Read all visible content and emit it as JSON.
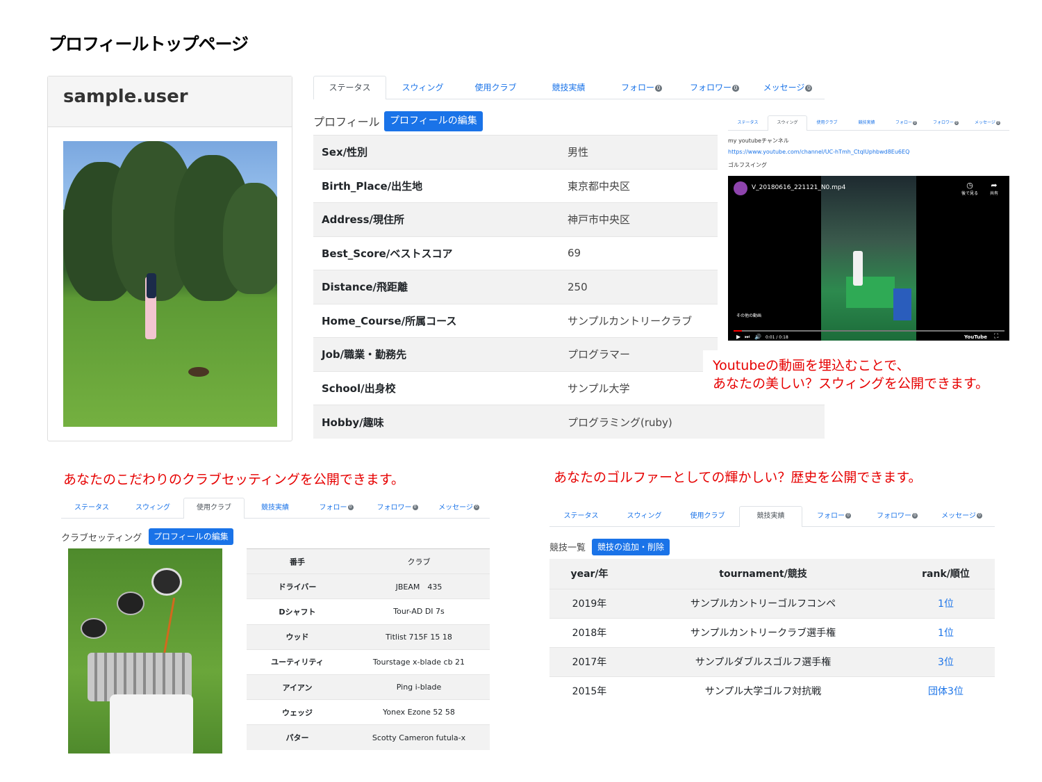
{
  "page_title": "プロフィールトップページ",
  "profile_card": {
    "username": "sample.user"
  },
  "tabs": [
    {
      "label": "ステータス",
      "badge": ""
    },
    {
      "label": "スウィング",
      "badge": ""
    },
    {
      "label": "使用クラブ",
      "badge": ""
    },
    {
      "label": "競技実績",
      "badge": ""
    },
    {
      "label": "フォロー",
      "badge": "0"
    },
    {
      "label": "フォロワー",
      "badge": "0"
    },
    {
      "label": "メッセージ",
      "badge": "0"
    }
  ],
  "status": {
    "section_label": "プロフィール",
    "edit_button": "プロフィールの編集",
    "rows": [
      {
        "key": "Sex/性別",
        "value": "男性"
      },
      {
        "key": "Birth_Place/出生地",
        "value": "東京都中央区"
      },
      {
        "key": "Address/現住所",
        "value": "神戸市中央区"
      },
      {
        "key": "Best_Score/ベストスコア",
        "value": "69"
      },
      {
        "key": "Distance/飛距離",
        "value": "250"
      },
      {
        "key": "Home_Course/所属コース",
        "value": "サンプルカントリークラブ"
      },
      {
        "key": "Job/職業・勤務先",
        "value": "プログラマー"
      },
      {
        "key": "School/出身校",
        "value": "サンプル大学"
      },
      {
        "key": "Hobby/趣味",
        "value": "プログラミング(ruby)"
      }
    ]
  },
  "swing_preview": {
    "channel_label": "my youtubeチャンネル",
    "channel_url": "https://www.youtube.com/channel/UC-hTmh_CtqIUphbwd8Eu6EQ",
    "video_section": "ゴルフスイング",
    "video_title": "V_20180616_221121_N0.mp4",
    "watch_later": "後で見る",
    "share": "共有",
    "more_videos": "その他の動画",
    "time": "0:01 / 0:18",
    "youtube": "YouTube"
  },
  "annotations": {
    "youtube_line1": "Youtubeの動画を埋込むことで、",
    "youtube_line2": "あなたの美しい？スウィングを公開できます。",
    "clubs": "あなたのこだわりのクラブセッティングを公開できます。",
    "history": "あなたのゴルファーとしての輝かしい？歴史を公開できます。"
  },
  "clubs": {
    "section_label": "クラブセッティング",
    "edit_button": "プロフィールの編集",
    "headers": [
      "番手",
      "クラブ"
    ],
    "rows": [
      {
        "key": "ドライバー",
        "value": "JBEAM　435"
      },
      {
        "key": "Dシャフト",
        "value": "Tour-AD DI 7s"
      },
      {
        "key": "ウッド",
        "value": "Titlist 715F 15 18"
      },
      {
        "key": "ユーティリティ",
        "value": "Tourstage x-blade cb 21"
      },
      {
        "key": "アイアン",
        "value": "Ping i-blade"
      },
      {
        "key": "ウェッジ",
        "value": "Yonex Ezone 52 58"
      },
      {
        "key": "パター",
        "value": "Scotty Cameron futula-x"
      }
    ]
  },
  "results": {
    "section_label": "競技一覧",
    "add_button": "競技の追加・削除",
    "headers": [
      "year/年",
      "tournament/競技",
      "rank/順位"
    ],
    "rows": [
      {
        "year": "2019年",
        "tournament": "サンプルカントリーゴルフコンペ",
        "rank": "1位"
      },
      {
        "year": "2018年",
        "tournament": "サンプルカントリークラブ選手権",
        "rank": "1位"
      },
      {
        "year": "2017年",
        "tournament": "サンプルダブルスゴルフ選手権",
        "rank": "3位"
      },
      {
        "year": "2015年",
        "tournament": "サンプル大学ゴルフ対抗戦",
        "rank": "団体3位"
      }
    ]
  }
}
